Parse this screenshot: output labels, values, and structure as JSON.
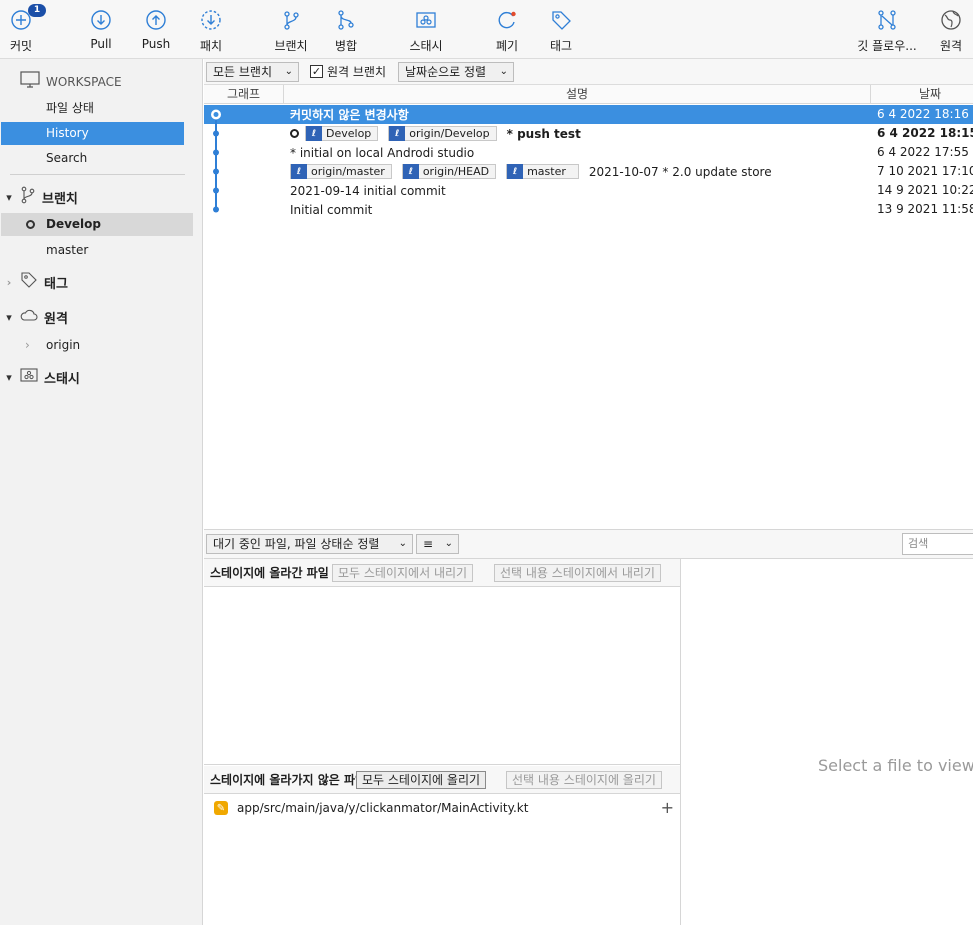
{
  "toolbar": {
    "commit": {
      "label": "커밋",
      "badge": "1"
    },
    "pull": "Pull",
    "push": "Push",
    "patch": "패치",
    "branch": "브랜치",
    "merge": "병합",
    "stash": "스태시",
    "discard": "폐기",
    "tag": "태그",
    "gitflow": "깃 플로우...",
    "remote": "원격"
  },
  "sidebar": {
    "workspace": "WORKSPACE",
    "workspace_items": [
      "파일 상태",
      "History",
      "Search"
    ],
    "branches_label": "브랜치",
    "branches": [
      "Develop",
      "master"
    ],
    "tags_label": "태그",
    "remotes_label": "원격",
    "remotes": [
      "origin"
    ],
    "stash_label": "스태시"
  },
  "filters": {
    "branches_dropdown": "모든 브랜치",
    "remote_branches_label": "원격 브랜치",
    "remote_branches_checked": true,
    "sort_dropdown": "날짜순으로 정렬"
  },
  "columns": {
    "graph": "그래프",
    "description": "설명",
    "date": "날짜"
  },
  "commits": [
    {
      "desc": "커밋하지 않은 변경사항",
      "date": "6 4 2022 18:16",
      "bold": true,
      "refs": []
    },
    {
      "desc": "* push test",
      "date": "6 4 2022 18:15",
      "bold": true,
      "refs": [
        "Develop",
        "origin/Develop"
      ]
    },
    {
      "desc": "* initial on local Androdi studio",
      "date": "6 4 2022 17:55",
      "bold": false,
      "refs": []
    },
    {
      "desc": "2021-10-07 * 2.0 update store",
      "date": "7 10 2021 17:10",
      "bold": false,
      "refs": [
        "origin/master",
        "origin/HEAD",
        "master"
      ]
    },
    {
      "desc": "2021-09-14 initial commit",
      "date": "14 9 2021 10:22",
      "bold": false,
      "refs": []
    },
    {
      "desc": "Initial commit",
      "date": "13 9 2021 11:58",
      "bold": false,
      "refs": []
    }
  ],
  "bottom": {
    "pending_dropdown": "대기 중인 파일, 파일 상태순 정렬",
    "view_dropdown": "≡",
    "search_placeholder": "검색",
    "staged_title": "스테이지에 올라간 파일",
    "unstage_all": "모두 스테이지에서 내리기",
    "unstage_selected": "선택 내용 스테이지에서 내리기",
    "unstaged_title": "스테이지에 올라가지 않은 파일",
    "stage_all": "모두 스테이지에 올리기",
    "stage_selected": "선택 내용 스테이지에 올리기",
    "unstaged_files": [
      "app/src/main/java/y/clickanmator/MainActivity.kt"
    ],
    "diff_placeholder": "Select a file to view t"
  },
  "colors": {
    "accent": "#3b8fe0",
    "ref_icon": "#2f63b6",
    "graph": "#2f7fd6",
    "modified": "#f0a800"
  }
}
